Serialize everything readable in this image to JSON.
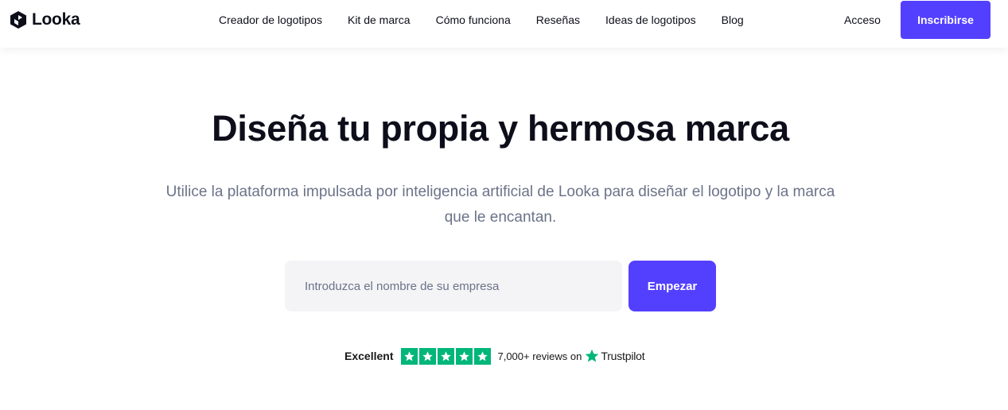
{
  "header": {
    "brand": "Looka",
    "nav": [
      {
        "label": "Creador de logotipos",
        "name": "nav-logo-maker"
      },
      {
        "label": "Kit de marca",
        "name": "nav-brand-kit"
      },
      {
        "label": "Cómo funciona",
        "name": "nav-how-it-works"
      },
      {
        "label": "Reseñas",
        "name": "nav-reviews"
      },
      {
        "label": "Ideas de logotipos",
        "name": "nav-logo-ideas"
      },
      {
        "label": "Blog",
        "name": "nav-blog"
      }
    ],
    "login_label": "Acceso",
    "signup_label": "Inscribirse"
  },
  "hero": {
    "title": "Diseña tu propia y hermosa marca",
    "subtitle": "Utilice la plataforma impulsada por inteligencia artificial de Looka para diseñar el logotipo y la marca que le encantan."
  },
  "search": {
    "placeholder": "Introduzca el nombre de su empresa",
    "value": "",
    "button_label": "Empezar"
  },
  "trustpilot": {
    "rating_label": "Excellent",
    "stars": 5,
    "reviews_text": "7,000+ reviews on",
    "brand": "Trustpilot",
    "star_color": "#00b67a"
  },
  "colors": {
    "accent": "#5340ff",
    "text_dark": "#0d0e1a",
    "text_muted": "#6b7388",
    "input_bg": "#f4f4f6"
  }
}
